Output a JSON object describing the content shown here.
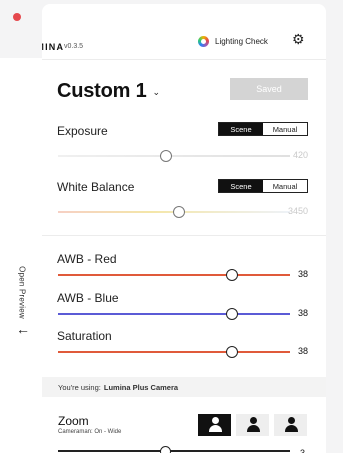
{
  "app": {
    "logo": "LUMINA",
    "version": "v0.3.5",
    "lighting_check": "Lighting Check",
    "gear_icon": "gear-icon"
  },
  "side": {
    "open_preview": "Open Preview",
    "arrow": "←"
  },
  "preset": {
    "title": "Custom 1",
    "caret": "⌄",
    "saved_label": "Saved"
  },
  "exposure": {
    "label": "Exposure",
    "mode_scene": "Scene",
    "mode_manual": "Manual",
    "active_mode": "Scene",
    "value": "420",
    "position_fraction": 0.47
  },
  "white_balance": {
    "label": "White Balance",
    "mode_scene": "Scene",
    "mode_manual": "Manual",
    "active_mode": "Scene",
    "value": "3450",
    "position_fraction": 0.52
  },
  "awb_red": {
    "label": "AWB - Red",
    "value": "38",
    "position_fraction": 0.75,
    "color": "#e05a3a"
  },
  "awb_blue": {
    "label": "AWB - Blue",
    "value": "38",
    "position_fraction": 0.75,
    "color": "#5b5bd6"
  },
  "saturation": {
    "label": "Saturation",
    "value": "38",
    "position_fraction": 0.75,
    "color": "#e05a3a"
  },
  "camera": {
    "prefix": "You're using:",
    "name": "Lumina Plus Camera"
  },
  "zoom": {
    "label": "Zoom",
    "sub": "Cameraman: On - Wide",
    "value": "3",
    "framing_options": [
      "wide",
      "medium",
      "close"
    ],
    "active_framing": "wide"
  }
}
